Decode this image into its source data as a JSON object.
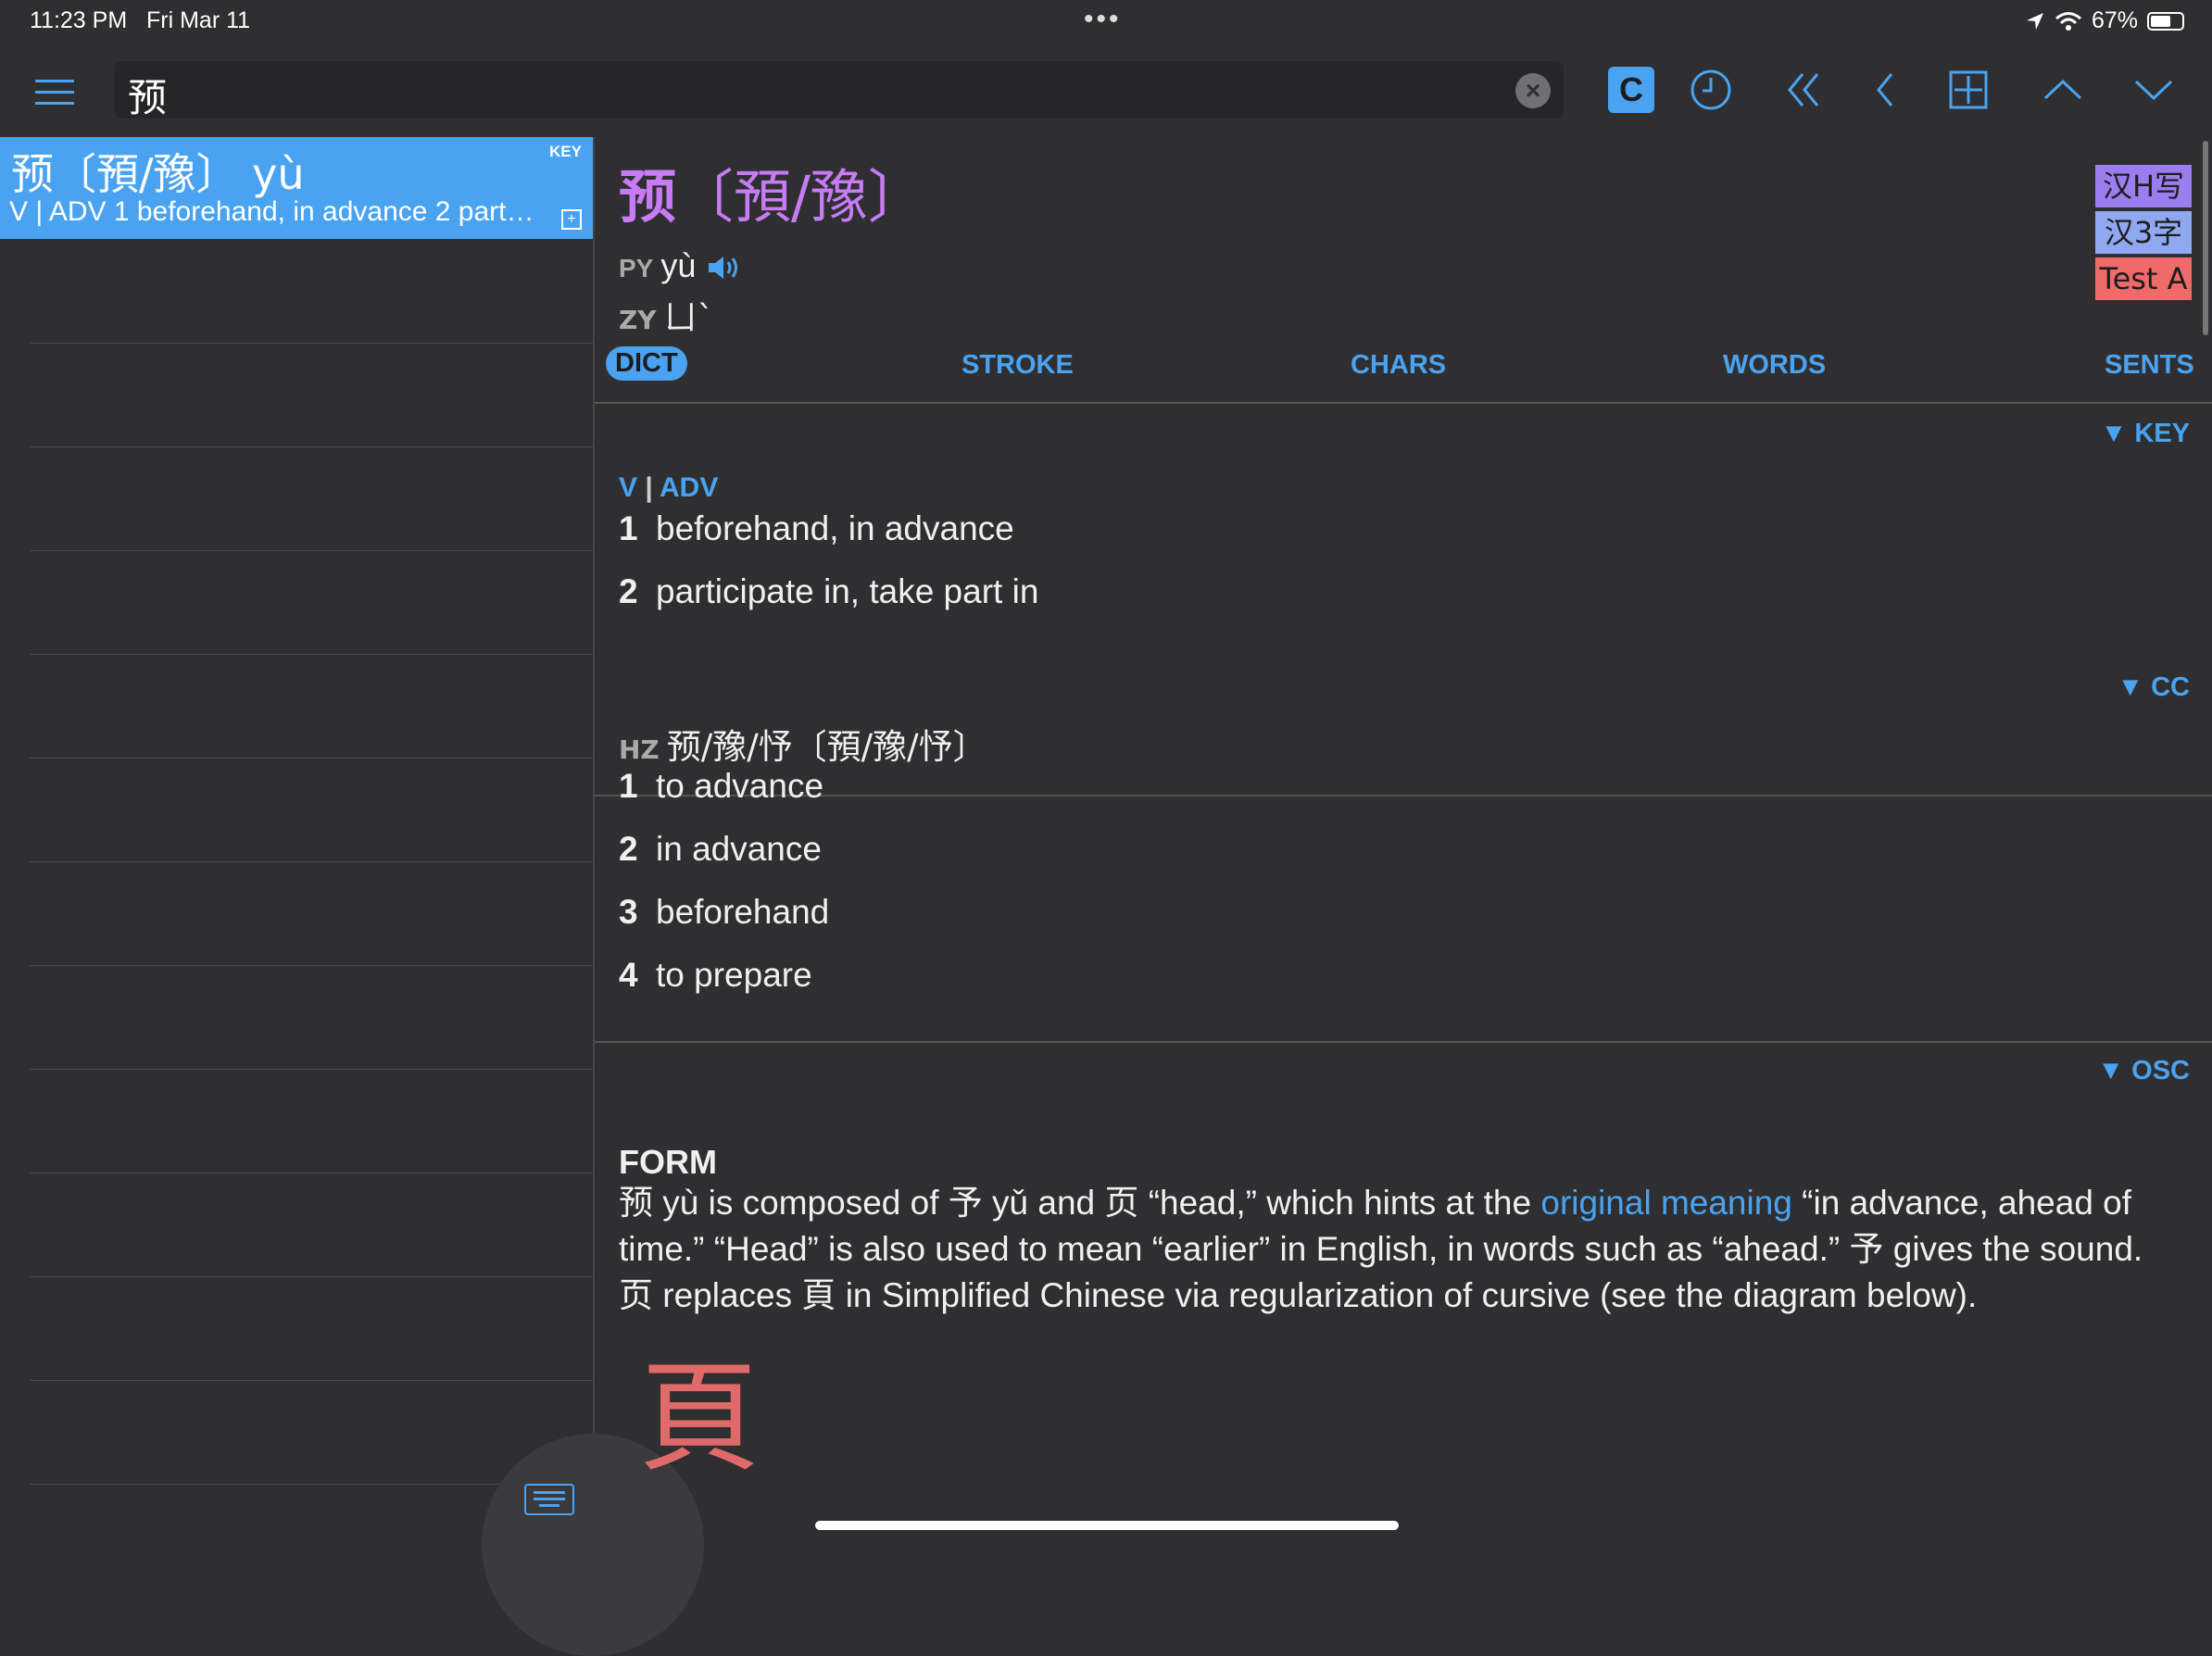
{
  "status_bar": {
    "time": "11:23 PM",
    "date": "Fri Mar 11",
    "battery": "67%",
    "battery_level": 0.67
  },
  "toolbar": {
    "search_value": "预",
    "c_button": "C"
  },
  "list": {
    "entries": [
      {
        "headword": "预〔預/豫〕 yù",
        "tag": "KEY",
        "summary": "V | ADV  1 beforehand, in advance  2 part…"
      }
    ]
  },
  "entry": {
    "headword_simplified": "预",
    "headword_traditional": "〔預/豫〕",
    "py_label": "PY",
    "pinyin": "yù",
    "zy_label": "ZY",
    "zhuyin": "ㄩˋ",
    "badges": [
      {
        "label": "汉H写",
        "color": "#9b7df0"
      },
      {
        "label": "汉3字",
        "color": "#8fa8f0"
      },
      {
        "label": "Test A",
        "color": "#f06a6a"
      }
    ],
    "tabs": [
      "DICT",
      "STROKE",
      "CHARS",
      "WORDS",
      "SENTS"
    ],
    "key_section": {
      "tag": "▼ KEY",
      "pos_v": "V",
      "pos_sep": "|",
      "pos_adv": "ADV",
      "defs": [
        {
          "n": "1",
          "text": "beforehand, in advance"
        },
        {
          "n": "2",
          "text": "participate in, take part in"
        }
      ]
    },
    "cc_section": {
      "tag": "▼ CC",
      "hz_label": "HZ",
      "hz_forms": "预/豫/忬〔預/豫/忬〕",
      "defs": [
        {
          "n": "1",
          "text": "to advance"
        },
        {
          "n": "2",
          "text": "in advance"
        },
        {
          "n": "3",
          "text": "beforehand"
        },
        {
          "n": "4",
          "text": "to prepare"
        }
      ]
    },
    "osc_section": {
      "tag": "▼ OSC",
      "form_heading": "FORM",
      "text_part1": "预 yù is composed of 予 yǔ and 页 “head,” which hints at the ",
      "link_text": "original meaning",
      "text_part2": " “in advance, ahead of time.” “Head” is also used to mean “earlier” in English, in words such as “ahead.” 予 gives the sound. 页 replaces 頁 in Simplified Chinese via regularization of cursive (see the diagram below).",
      "glyph": "頁"
    }
  }
}
